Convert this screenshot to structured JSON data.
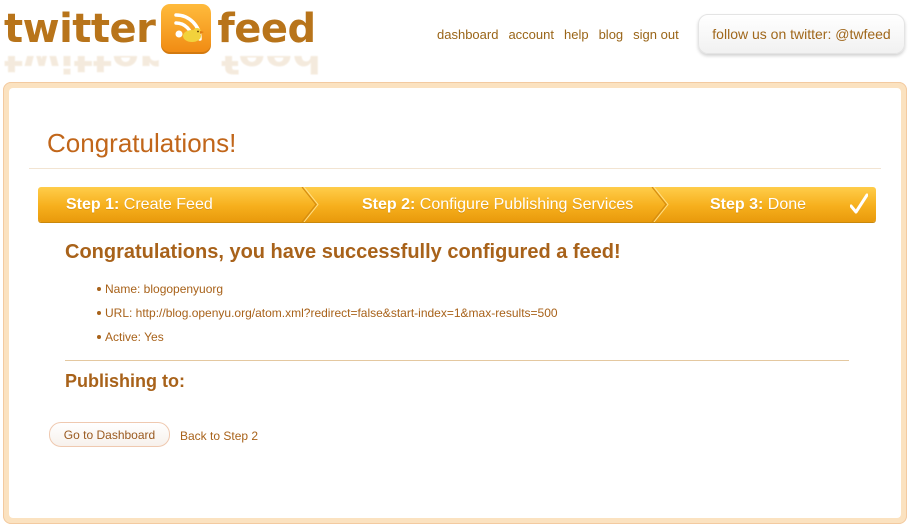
{
  "header": {
    "logo_left": "twitter",
    "logo_right": "feed",
    "nav": [
      "dashboard",
      "account",
      "help",
      "blog",
      "sign out"
    ],
    "follow_text": "follow us on twitter: @twfeed"
  },
  "page": {
    "title": "Congratulations!",
    "steps": [
      {
        "num": "Step 1:",
        "label": "Create Feed"
      },
      {
        "num": "Step 2:",
        "label": "Configure Publishing Services"
      },
      {
        "num": "Step 3:",
        "label": "Done"
      }
    ],
    "success_message": "Congratulations, you have successfully configured a feed!",
    "details": [
      "Name: blogopenyuorg",
      "URL: http://blog.openyu.org/atom.xml?redirect=false&start-index=1&max-results=500",
      "Active: Yes"
    ],
    "publishing_heading": "Publishing to:",
    "dashboard_button": "Go to Dashboard",
    "back_link": "Back to Step 2"
  },
  "colors": {
    "brand": "#b8741a",
    "accent": "#f6af1c",
    "text": "#a8621a"
  },
  "icons": [
    "rss-bird-icon",
    "checkmark-icon"
  ]
}
